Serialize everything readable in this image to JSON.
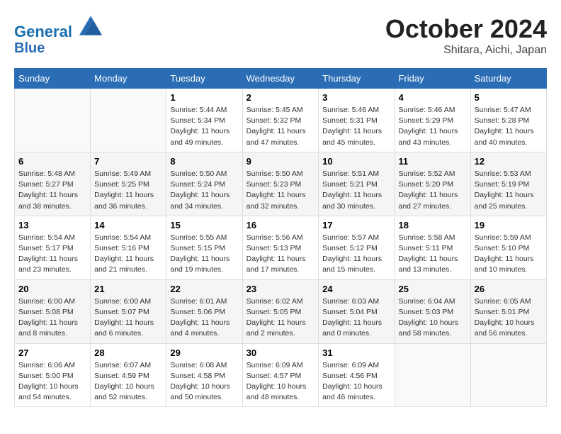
{
  "header": {
    "logo_line1": "General",
    "logo_line2": "Blue",
    "month": "October 2024",
    "location": "Shitara, Aichi, Japan"
  },
  "weekdays": [
    "Sunday",
    "Monday",
    "Tuesday",
    "Wednesday",
    "Thursday",
    "Friday",
    "Saturday"
  ],
  "weeks": [
    [
      {
        "day": "",
        "info": ""
      },
      {
        "day": "",
        "info": ""
      },
      {
        "day": "1",
        "info": "Sunrise: 5:44 AM\nSunset: 5:34 PM\nDaylight: 11 hours and 49 minutes."
      },
      {
        "day": "2",
        "info": "Sunrise: 5:45 AM\nSunset: 5:32 PM\nDaylight: 11 hours and 47 minutes."
      },
      {
        "day": "3",
        "info": "Sunrise: 5:46 AM\nSunset: 5:31 PM\nDaylight: 11 hours and 45 minutes."
      },
      {
        "day": "4",
        "info": "Sunrise: 5:46 AM\nSunset: 5:29 PM\nDaylight: 11 hours and 43 minutes."
      },
      {
        "day": "5",
        "info": "Sunrise: 5:47 AM\nSunset: 5:28 PM\nDaylight: 11 hours and 40 minutes."
      }
    ],
    [
      {
        "day": "6",
        "info": "Sunrise: 5:48 AM\nSunset: 5:27 PM\nDaylight: 11 hours and 38 minutes."
      },
      {
        "day": "7",
        "info": "Sunrise: 5:49 AM\nSunset: 5:25 PM\nDaylight: 11 hours and 36 minutes."
      },
      {
        "day": "8",
        "info": "Sunrise: 5:50 AM\nSunset: 5:24 PM\nDaylight: 11 hours and 34 minutes."
      },
      {
        "day": "9",
        "info": "Sunrise: 5:50 AM\nSunset: 5:23 PM\nDaylight: 11 hours and 32 minutes."
      },
      {
        "day": "10",
        "info": "Sunrise: 5:51 AM\nSunset: 5:21 PM\nDaylight: 11 hours and 30 minutes."
      },
      {
        "day": "11",
        "info": "Sunrise: 5:52 AM\nSunset: 5:20 PM\nDaylight: 11 hours and 27 minutes."
      },
      {
        "day": "12",
        "info": "Sunrise: 5:53 AM\nSunset: 5:19 PM\nDaylight: 11 hours and 25 minutes."
      }
    ],
    [
      {
        "day": "13",
        "info": "Sunrise: 5:54 AM\nSunset: 5:17 PM\nDaylight: 11 hours and 23 minutes."
      },
      {
        "day": "14",
        "info": "Sunrise: 5:54 AM\nSunset: 5:16 PM\nDaylight: 11 hours and 21 minutes."
      },
      {
        "day": "15",
        "info": "Sunrise: 5:55 AM\nSunset: 5:15 PM\nDaylight: 11 hours and 19 minutes."
      },
      {
        "day": "16",
        "info": "Sunrise: 5:56 AM\nSunset: 5:13 PM\nDaylight: 11 hours and 17 minutes."
      },
      {
        "day": "17",
        "info": "Sunrise: 5:57 AM\nSunset: 5:12 PM\nDaylight: 11 hours and 15 minutes."
      },
      {
        "day": "18",
        "info": "Sunrise: 5:58 AM\nSunset: 5:11 PM\nDaylight: 11 hours and 13 minutes."
      },
      {
        "day": "19",
        "info": "Sunrise: 5:59 AM\nSunset: 5:10 PM\nDaylight: 11 hours and 10 minutes."
      }
    ],
    [
      {
        "day": "20",
        "info": "Sunrise: 6:00 AM\nSunset: 5:08 PM\nDaylight: 11 hours and 8 minutes."
      },
      {
        "day": "21",
        "info": "Sunrise: 6:00 AM\nSunset: 5:07 PM\nDaylight: 11 hours and 6 minutes."
      },
      {
        "day": "22",
        "info": "Sunrise: 6:01 AM\nSunset: 5:06 PM\nDaylight: 11 hours and 4 minutes."
      },
      {
        "day": "23",
        "info": "Sunrise: 6:02 AM\nSunset: 5:05 PM\nDaylight: 11 hours and 2 minutes."
      },
      {
        "day": "24",
        "info": "Sunrise: 6:03 AM\nSunset: 5:04 PM\nDaylight: 11 hours and 0 minutes."
      },
      {
        "day": "25",
        "info": "Sunrise: 6:04 AM\nSunset: 5:03 PM\nDaylight: 10 hours and 58 minutes."
      },
      {
        "day": "26",
        "info": "Sunrise: 6:05 AM\nSunset: 5:01 PM\nDaylight: 10 hours and 56 minutes."
      }
    ],
    [
      {
        "day": "27",
        "info": "Sunrise: 6:06 AM\nSunset: 5:00 PM\nDaylight: 10 hours and 54 minutes."
      },
      {
        "day": "28",
        "info": "Sunrise: 6:07 AM\nSunset: 4:59 PM\nDaylight: 10 hours and 52 minutes."
      },
      {
        "day": "29",
        "info": "Sunrise: 6:08 AM\nSunset: 4:58 PM\nDaylight: 10 hours and 50 minutes."
      },
      {
        "day": "30",
        "info": "Sunrise: 6:09 AM\nSunset: 4:57 PM\nDaylight: 10 hours and 48 minutes."
      },
      {
        "day": "31",
        "info": "Sunrise: 6:09 AM\nSunset: 4:56 PM\nDaylight: 10 hours and 46 minutes."
      },
      {
        "day": "",
        "info": ""
      },
      {
        "day": "",
        "info": ""
      }
    ]
  ]
}
